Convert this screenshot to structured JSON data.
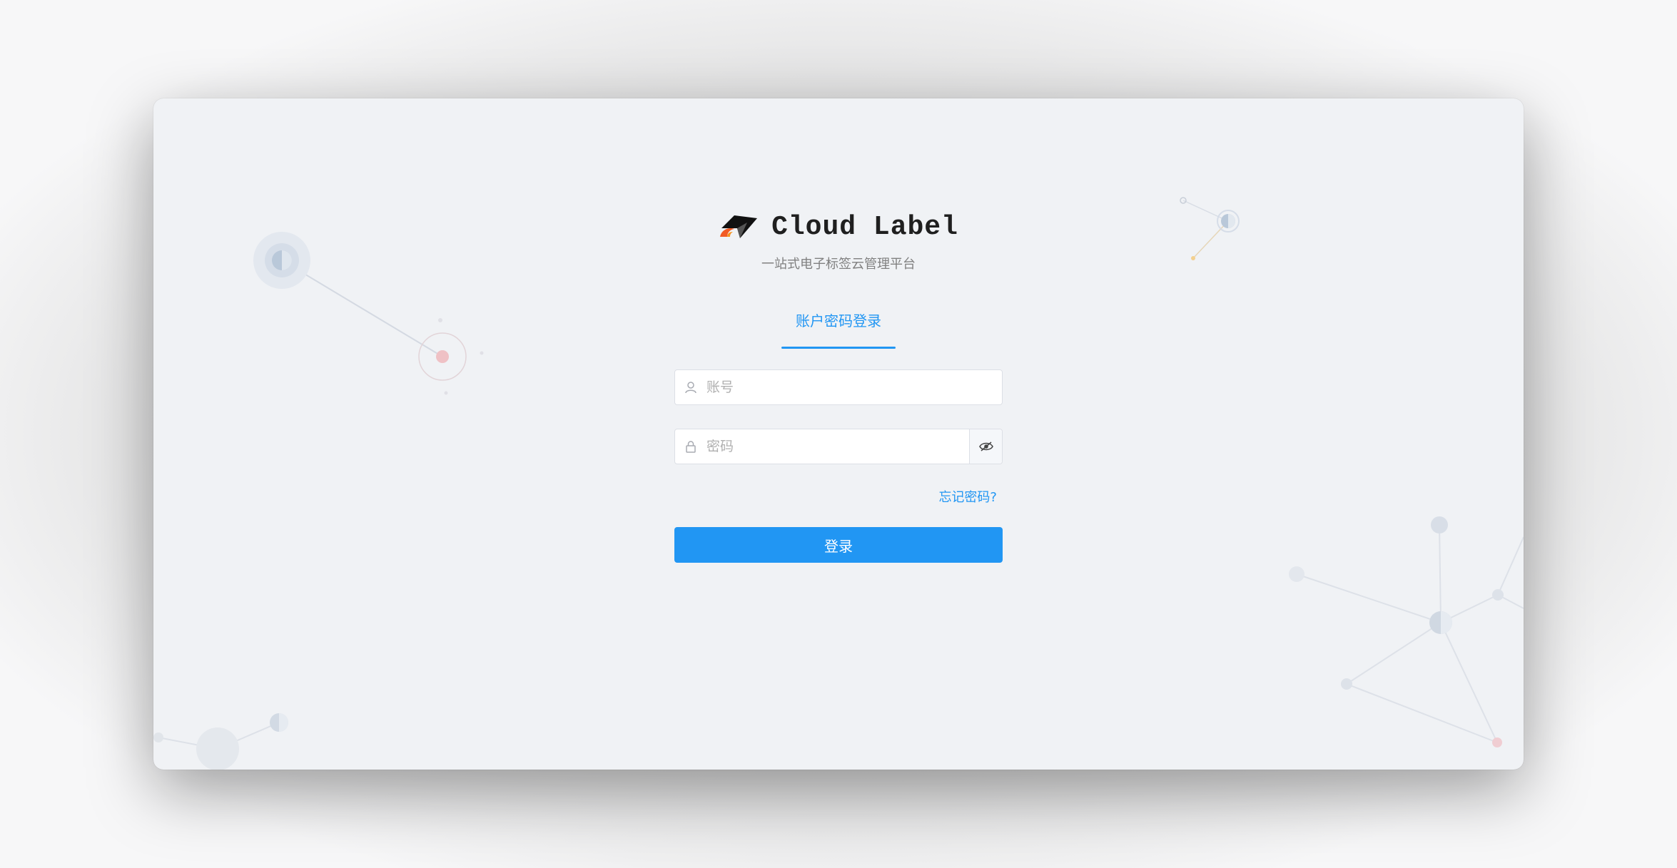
{
  "app": {
    "name": "Cloud Label",
    "subtitle": "一站式电子标签云管理平台"
  },
  "login": {
    "tab_label": "账户密码登录",
    "account_placeholder": "账号",
    "password_placeholder": "密码",
    "forgot_label": "忘记密码?",
    "submit_label": "登录"
  },
  "icons": {
    "logo": "bird-logo-icon",
    "user": "user-icon",
    "lock": "lock-icon",
    "eye": "eye-toggle-icon"
  },
  "colors": {
    "accent": "#2196f3",
    "background": "#f0f2f5",
    "logo_orange": "#f15a24"
  }
}
